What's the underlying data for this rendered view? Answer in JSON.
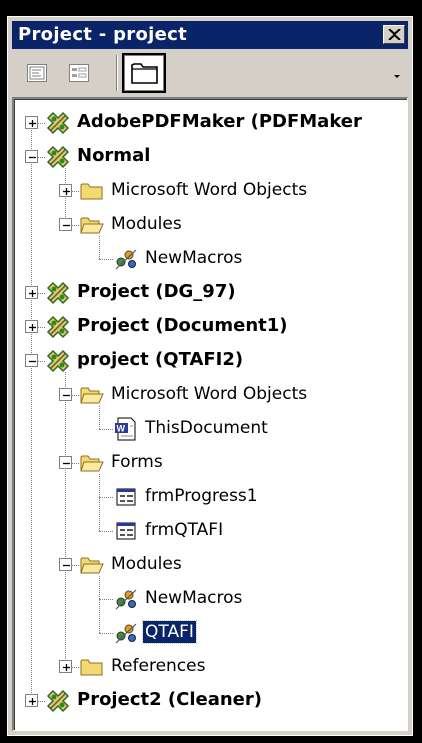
{
  "window": {
    "title": "Project - project",
    "close_icon": "close-x-icon"
  },
  "toolbar": {
    "buttons": [
      {
        "name": "view-code",
        "icon": "view-code-icon"
      },
      {
        "name": "view-object",
        "icon": "view-object-icon"
      },
      {
        "name": "toggle-folders",
        "icon": "folder-icon",
        "pressed": true
      }
    ],
    "overflow_icon": "dropdown-arrow-icon"
  },
  "colors": {
    "title_bg": "#0a246a",
    "selection_bg": "#0a246a",
    "panel_bg": "#d4d0c8",
    "folder_yellow": "#f4d870"
  },
  "tree": {
    "nodes": [
      {
        "label": "AdobePDFMaker (PDFMaker",
        "type": "project",
        "bold": true,
        "expander": "plus"
      },
      {
        "label": "Normal",
        "type": "project",
        "bold": true,
        "expander": "minus"
      },
      {
        "label": "Microsoft Word Objects",
        "type": "folder",
        "bold": false,
        "expander": "plus"
      },
      {
        "label": "Modules",
        "type": "folder-open",
        "bold": false,
        "expander": "minus"
      },
      {
        "label": "NewMacros",
        "type": "module",
        "bold": false,
        "expander": ""
      },
      {
        "label": "Project (DG_97)",
        "type": "project",
        "bold": true,
        "expander": "plus"
      },
      {
        "label": "Project (Document1)",
        "type": "project",
        "bold": true,
        "expander": "plus"
      },
      {
        "label": "project (QTAFI2)",
        "type": "project",
        "bold": true,
        "expander": "minus"
      },
      {
        "label": "Microsoft Word Objects",
        "type": "folder-open",
        "bold": false,
        "expander": "minus"
      },
      {
        "label": "ThisDocument",
        "type": "word-doc",
        "bold": false,
        "expander": ""
      },
      {
        "label": "Forms",
        "type": "folder-open",
        "bold": false,
        "expander": "minus"
      },
      {
        "label": "frmProgress1",
        "type": "form",
        "bold": false,
        "expander": ""
      },
      {
        "label": "frmQTAFI",
        "type": "form",
        "bold": false,
        "expander": ""
      },
      {
        "label": "Modules",
        "type": "folder-open",
        "bold": false,
        "expander": "minus"
      },
      {
        "label": "NewMacros",
        "type": "module",
        "bold": false,
        "expander": ""
      },
      {
        "label": "QTAFI",
        "type": "module",
        "bold": false,
        "expander": "",
        "selected": true
      },
      {
        "label": "References",
        "type": "folder",
        "bold": false,
        "expander": "plus"
      },
      {
        "label": "Project2 (Cleaner)",
        "type": "project",
        "bold": true,
        "expander": "plus"
      }
    ]
  }
}
